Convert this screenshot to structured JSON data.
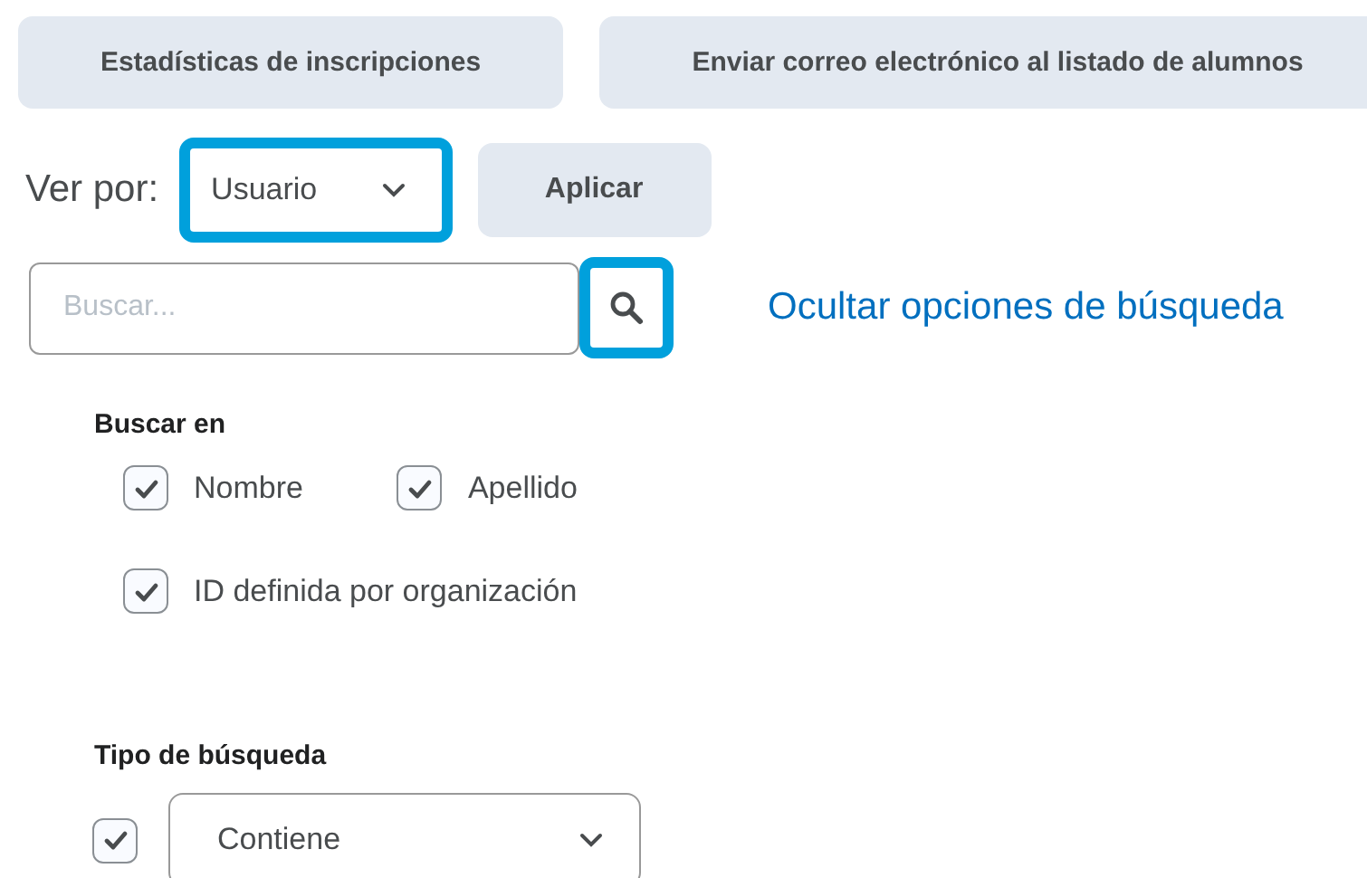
{
  "top_buttons": [
    {
      "label": "Estadísticas de inscripciones"
    },
    {
      "label": "Enviar correo electrónico al listado de alumnos"
    }
  ],
  "view_by": {
    "label": "Ver por:",
    "value": "Usuario",
    "highlighted": true
  },
  "apply_button": {
    "label": "Aplicar"
  },
  "search": {
    "placeholder": "Buscar...",
    "button_highlighted": true
  },
  "toggle_link": "Ocultar opciones de búsqueda",
  "search_in": {
    "title": "Buscar en",
    "options": [
      {
        "label": "Nombre",
        "checked": true
      },
      {
        "label": "Apellido",
        "checked": true
      },
      {
        "label": "ID definida por organización",
        "checked": true
      }
    ]
  },
  "search_type": {
    "title": "Tipo de búsqueda",
    "checked": true,
    "value": "Contiene"
  }
}
